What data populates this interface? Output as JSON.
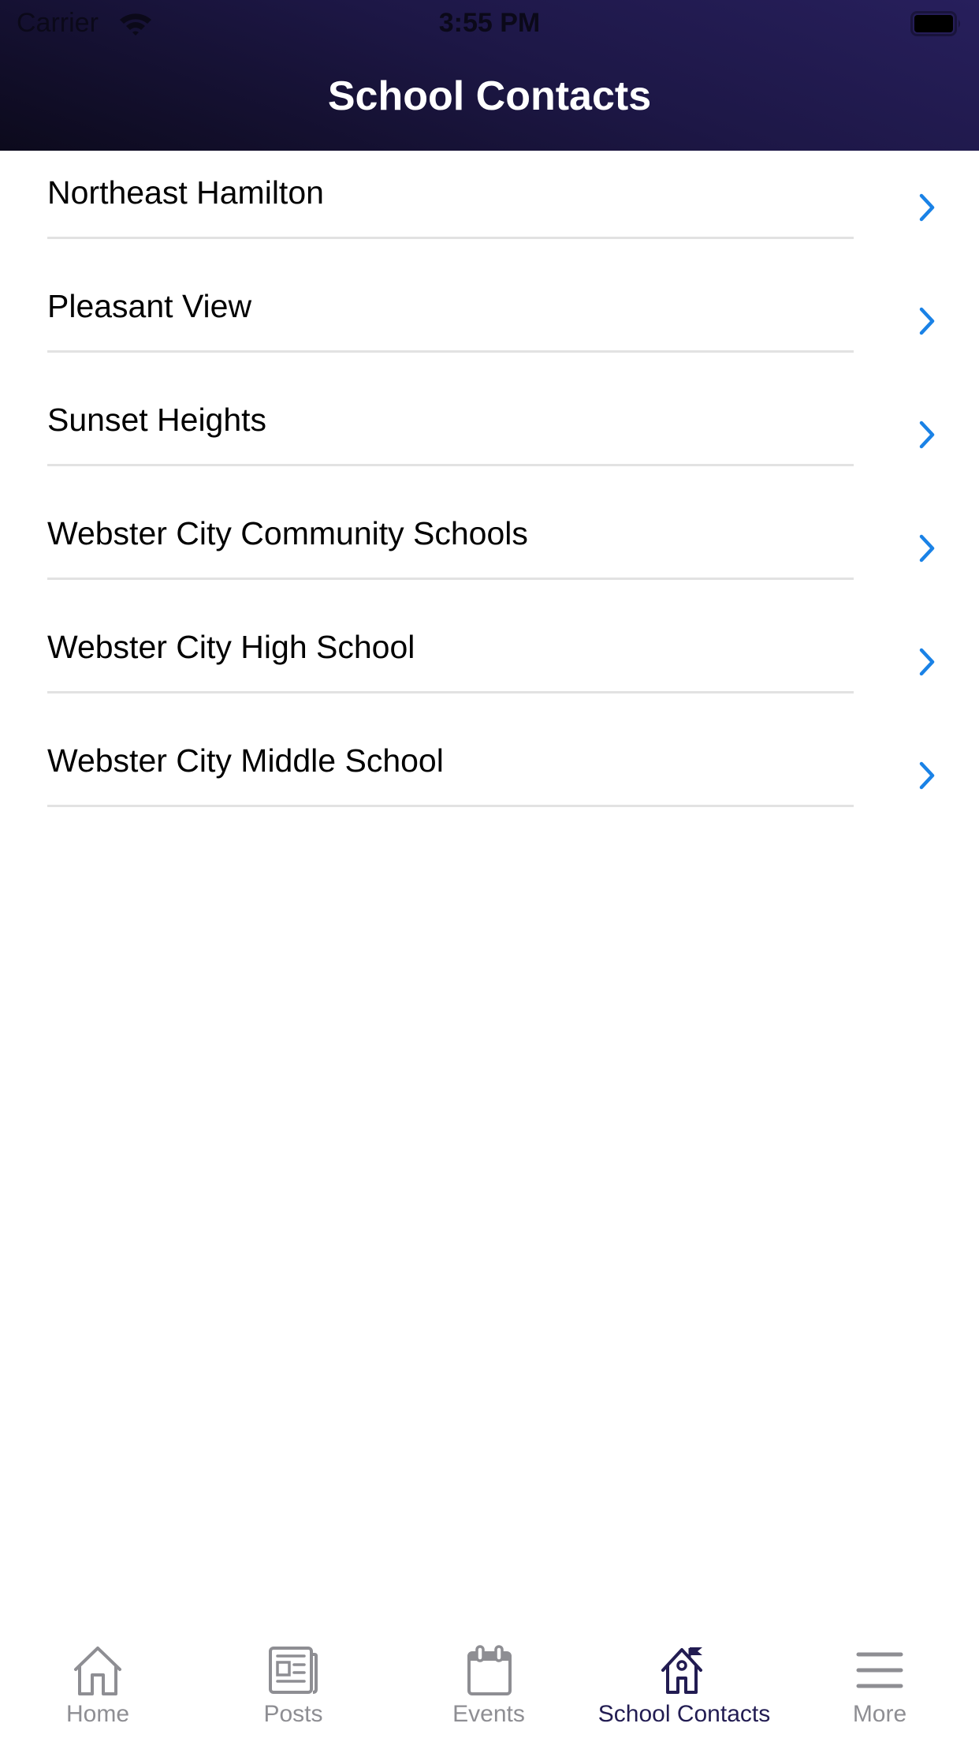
{
  "status_bar": {
    "carrier": "Carrier",
    "time": "3:55 PM",
    "wifi_icon": "wifi-icon",
    "battery_icon": "battery-icon"
  },
  "header": {
    "title": "School Contacts"
  },
  "colors": {
    "header_gradient_top": "#271f5c",
    "header_gradient_bottom": "#0c0a1c",
    "chevron": "#1a82e6",
    "tab_active": "#221c52",
    "tab_inactive": "#8e8e93",
    "separator": "#e2e2e2"
  },
  "list": {
    "items": [
      {
        "label": "Northeast Hamilton",
        "icon": "chevron-right-icon"
      },
      {
        "label": "Pleasant View",
        "icon": "chevron-right-icon"
      },
      {
        "label": "Sunset Heights",
        "icon": "chevron-right-icon"
      },
      {
        "label": "Webster City Community Schools",
        "icon": "chevron-right-icon"
      },
      {
        "label": "Webster City High School",
        "icon": "chevron-right-icon"
      },
      {
        "label": "Webster City Middle School",
        "icon": "chevron-right-icon"
      }
    ]
  },
  "tabbar": {
    "tabs": [
      {
        "label": "Home",
        "icon": "home-icon",
        "active": false
      },
      {
        "label": "Posts",
        "icon": "newspaper-icon",
        "active": false
      },
      {
        "label": "Events",
        "icon": "calendar-icon",
        "active": false
      },
      {
        "label": "School Contacts",
        "icon": "school-icon",
        "active": true
      },
      {
        "label": "More",
        "icon": "menu-icon",
        "active": false
      }
    ]
  }
}
